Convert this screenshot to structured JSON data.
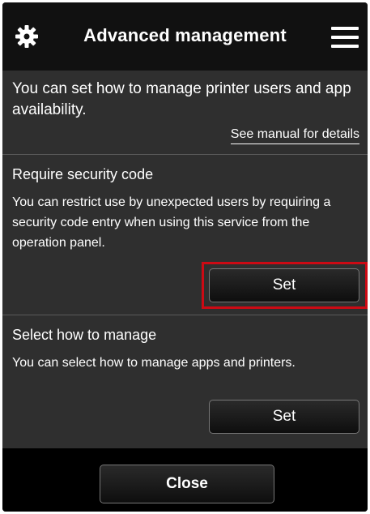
{
  "header": {
    "title": "Advanced management",
    "settings_icon": "gear-icon",
    "menu_icon": "hamburger-menu-icon"
  },
  "intro": {
    "text": "You can set how to manage printer users and app availability.",
    "manual_link": "See manual for details"
  },
  "security": {
    "title": "Require security code",
    "description": "You can restrict use by unexpected users by requiring a security code entry when using this service from the operation panel.",
    "button_label": "Set"
  },
  "manage": {
    "title": "Select how to manage",
    "description": "You can select how to manage apps and printers.",
    "button_label": "Set"
  },
  "footer": {
    "close_label": "Close"
  },
  "colors": {
    "highlight": "#cc0a14",
    "panel": "#2f2f2f",
    "header": "#111111"
  }
}
